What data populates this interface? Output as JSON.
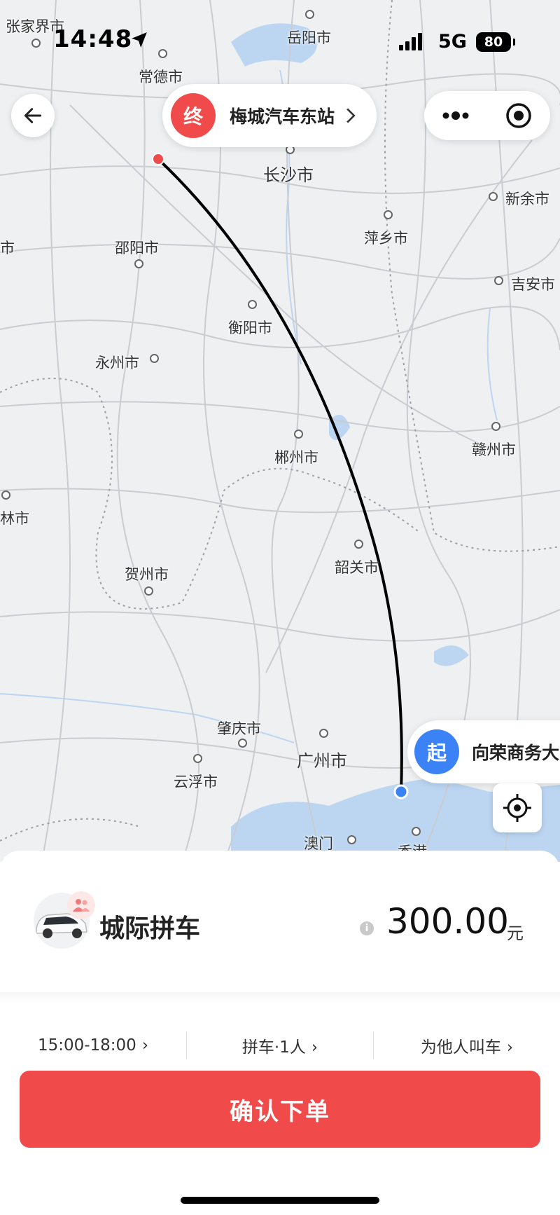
{
  "status_bar": {
    "time": "14:48",
    "network": "5G",
    "battery": "80"
  },
  "map": {
    "cities": [
      {
        "id": "zhangjiajie",
        "label": "张家界市"
      },
      {
        "id": "yueyang",
        "label": "岳阳市"
      },
      {
        "id": "changde",
        "label": "常德市"
      },
      {
        "id": "changsha",
        "label": "长沙市"
      },
      {
        "id": "xinyu",
        "label": "新余市"
      },
      {
        "id": "pingxiang",
        "label": "萍乡市"
      },
      {
        "id": "shi",
        "label": "市"
      },
      {
        "id": "shaoyang",
        "label": "邵阳市"
      },
      {
        "id": "jian",
        "label": "吉安市"
      },
      {
        "id": "hengyang",
        "label": "衡阳市"
      },
      {
        "id": "yongzhou",
        "label": "永州市"
      },
      {
        "id": "ganzhou",
        "label": "赣州市"
      },
      {
        "id": "chenzhou",
        "label": "郴州市"
      },
      {
        "id": "lin",
        "label": "林市"
      },
      {
        "id": "shaoguan",
        "label": "韶关市"
      },
      {
        "id": "hezhou",
        "label": "贺州市"
      },
      {
        "id": "zhaoqing",
        "label": "肇庆市"
      },
      {
        "id": "guangzhou",
        "label": "广州市"
      },
      {
        "id": "yunfu",
        "label": "云浮市"
      },
      {
        "id": "macau",
        "label": "澳门"
      },
      {
        "id": "hongkong",
        "label": "香港"
      }
    ]
  },
  "destination": {
    "badge": "终",
    "name": "梅城汽车东站"
  },
  "origin": {
    "badge": "起",
    "name": "向荣商务大"
  },
  "colors": {
    "accent": "#f04a4a",
    "origin": "#3b82f6",
    "route": "#000000"
  },
  "ride": {
    "product": "城际拼车",
    "price": "300.00",
    "unit": "元"
  },
  "options": [
    {
      "id": "time",
      "label": "15:00-18:00"
    },
    {
      "id": "seats",
      "label": "拼车·1人"
    },
    {
      "id": "for_others",
      "label": "为他人叫车"
    }
  ],
  "confirm_label": "确认下单",
  "icons": {
    "back": "arrow-left-icon",
    "more": "more-dots-icon",
    "record": "target-icon",
    "locate": "crosshair-icon",
    "info": "info-icon",
    "chevron": "chevron-right-icon"
  }
}
